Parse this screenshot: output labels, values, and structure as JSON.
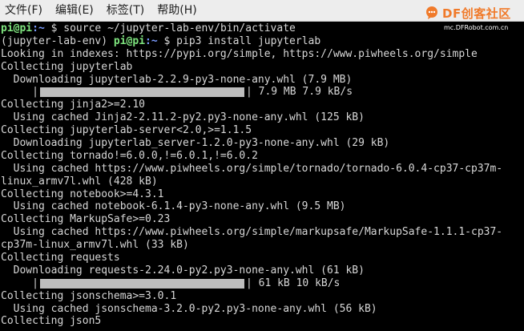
{
  "menubar": {
    "items": [
      "文件(F)",
      "编辑(E)",
      "标签(T)",
      "帮助(H)"
    ]
  },
  "watermark": {
    "logo": "DF创客社区",
    "url": "mc.DFRobot.com.cn"
  },
  "terminal": {
    "prompt1": {
      "user": "pi@pi",
      "sep": ":",
      "path": "~",
      "dollar": " $ ",
      "command": "source ~/jupyter-lab-env/bin/activate"
    },
    "prompt2": {
      "env": "(jupyter-lab-env) ",
      "user": "pi@pi",
      "sep": ":",
      "path": "~",
      "dollar": " $ ",
      "command": "pip3 install jupyterlab"
    },
    "lines_a": [
      "Looking in indexes: https://pypi.org/simple, https://www.piwheels.org/simple",
      "Collecting jupyterlab",
      "  Downloading jupyterlab-2.2.9-py3-none-any.whl (7.9 MB)"
    ],
    "progress1": {
      "fraction": 1.0,
      "text": " 7.9 MB 7.9 kB/s"
    },
    "lines_b": [
      "Collecting jinja2>=2.10",
      "  Using cached Jinja2-2.11.2-py2.py3-none-any.whl (125 kB)",
      "Collecting jupyterlab-server<2.0,>=1.1.5",
      "  Downloading jupyterlab_server-1.2.0-py3-none-any.whl (29 kB)",
      "Collecting tornado!=6.0.0,!=6.0.1,!=6.0.2",
      "  Using cached https://www.piwheels.org/simple/tornado/tornado-6.0.4-cp37-cp37m-",
      "linux_armv7l.whl (428 kB)",
      "Collecting notebook>=4.3.1",
      "  Using cached notebook-6.1.4-py3-none-any.whl (9.5 MB)",
      "Collecting MarkupSafe>=0.23",
      "  Using cached https://www.piwheels.org/simple/markupsafe/MarkupSafe-1.1.1-cp37-",
      "cp37m-linux_armv7l.whl (33 kB)",
      "Collecting requests",
      "  Downloading requests-2.24.0-py2.py3-none-any.whl (61 kB)"
    ],
    "progress2": {
      "fraction": 1.0,
      "text": " 61 kB 10 kB/s"
    },
    "lines_c": [
      "Collecting jsonschema>=3.0.1",
      "  Using cached jsonschema-3.2.0-py2.py3-none-any.whl (56 kB)",
      "Collecting json5"
    ]
  },
  "colors": {
    "background": "#000000",
    "text": "#d7d7d7",
    "prompt_user": "#7fe57f",
    "prompt_path": "#7b9cff",
    "menubar": "#ededed"
  }
}
